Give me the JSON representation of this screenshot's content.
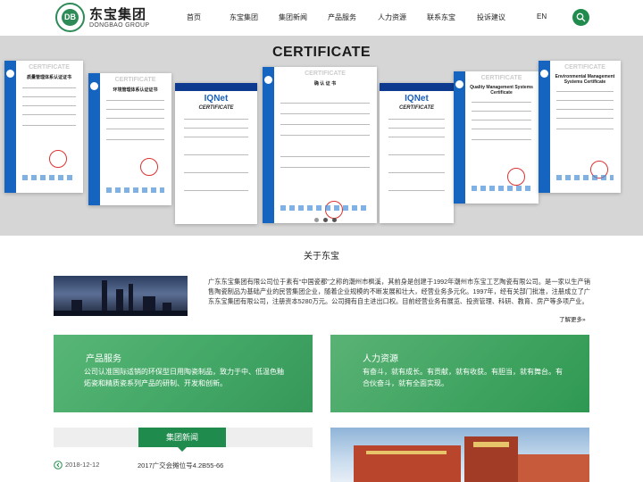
{
  "header": {
    "logo_cn": "东宝集团",
    "logo_en": "DONGBAO GROUP",
    "logo_mark": "DB",
    "nav": [
      "首页",
      "东宝集团",
      "集团新闻",
      "产品服务",
      "人力资源",
      "联系东宝",
      "投诉建议",
      "EN"
    ]
  },
  "banner": {
    "title": "CERTIFICATE",
    "certs": [
      {
        "hdr": "CERTIFICATE",
        "sub": "质量管理体系认证证书"
      },
      {
        "hdr": "CERTIFICATE",
        "sub": "环境管理体系认证证书"
      },
      {
        "hdr": "IQNet",
        "sub": "CERTIFICATE"
      },
      {
        "hdr": "CERTIFICATE",
        "sub": "确 认 证 书"
      },
      {
        "hdr": "IQNet",
        "sub": "CERTIFICATE"
      },
      {
        "hdr": "CERTIFICATE",
        "sub": "Quality Management Systems Certificate"
      },
      {
        "hdr": "CERTIFICATE",
        "sub": "Environmental Management Systems Certificate"
      }
    ]
  },
  "about": {
    "title": "关于东宝",
    "text": "广东东宝集团有限公司位于素有“中国瓷都”之称的潮州市枫溪，其前身是创建于1992年潮州市东宝工艺陶瓷有限公司。是一家以生产销售陶瓷制品为基础产业的民营集团企业，随着企业规模的不断发展和壮大，经营业务多元化。1997年，经有关部门批准，注册成立了广东东宝集团有限公司，注册资本5280万元。公司拥有自主进出口权。目前经营业务有展览、投资管理、科研、教育、房产等多项产业。",
    "more": "了解更多»"
  },
  "panels": {
    "products": {
      "title": "产品服务",
      "text": "公司认准国际适销的环保型日用陶瓷制品，致力于中、低温色釉炻瓷和精质瓷系列产品的研制、开发和创新。"
    },
    "hr": {
      "title": "人力资源",
      "text": "有奋斗，就有成长。有贡献，就有收获。有胆当，就有舞台。有合伙奋斗，就有全面实现。"
    }
  },
  "news": {
    "tab": "集团新闻",
    "items": [
      {
        "date": "2018-12-12",
        "title": "2017广交会摊位号4.2B55-66"
      }
    ]
  },
  "colors": {
    "brand_green": "#1f8b4c",
    "cert_blue": "#1565c0"
  }
}
